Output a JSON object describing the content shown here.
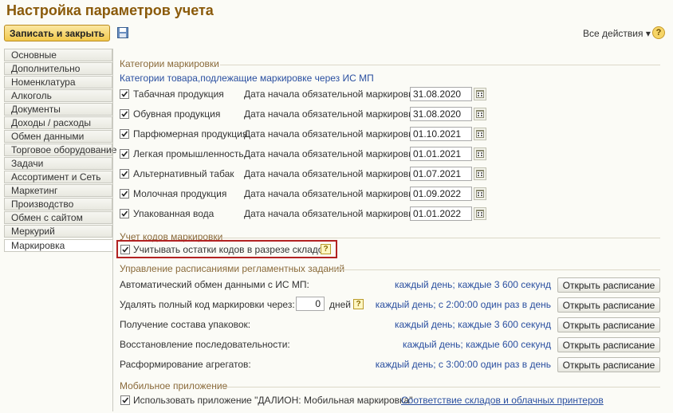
{
  "window_title": "Настройка параметров учета",
  "toolbar": {
    "save_close_label": "Записать и закрыть",
    "all_actions_label": "Все действия",
    "help_label": "?"
  },
  "sidebar": {
    "items": [
      {
        "label": "Основные"
      },
      {
        "label": "Дополнительно"
      },
      {
        "label": "Номенклатура"
      },
      {
        "label": "Алкоголь"
      },
      {
        "label": "Документы"
      },
      {
        "label": "Доходы / расходы"
      },
      {
        "label": "Обмен данными"
      },
      {
        "label": "Торговое оборудование"
      },
      {
        "label": "Задачи"
      },
      {
        "label": "Ассортимент и Сеть"
      },
      {
        "label": "Маркетинг"
      },
      {
        "label": "Производство"
      },
      {
        "label": "Обмен с сайтом"
      },
      {
        "label": "Меркурий"
      },
      {
        "label": "Маркировка"
      }
    ],
    "active": "Маркировка"
  },
  "categories": {
    "section_title": "Категории маркировки",
    "subtitle": "Категории товара,подлежащие маркировке через ИС МП",
    "date_label": "Дата начала обязательной маркировки:",
    "rows": [
      {
        "name": "Табачная продукция",
        "checked": true,
        "date": "31.08.2020"
      },
      {
        "name": "Обувная продукция",
        "checked": true,
        "date": "31.08.2020"
      },
      {
        "name": "Парфюмерная продукция",
        "checked": true,
        "date": "01.10.2021"
      },
      {
        "name": "Легкая промышленность",
        "checked": true,
        "date": "01.01.2021"
      },
      {
        "name": "Альтернативный табак",
        "checked": true,
        "date": "01.07.2021"
      },
      {
        "name": "Молочная продукция",
        "checked": true,
        "date": "01.09.2022"
      },
      {
        "name": "Упакованная вода",
        "checked": true,
        "date": "01.01.2022"
      }
    ]
  },
  "codes_accounting": {
    "section_title": "Учет кодов маркировки",
    "checkbox_label": "Учитывать остатки кодов в разрезе складов",
    "checked": true,
    "help_label": "?"
  },
  "schedules": {
    "section_title": "Управление расписаниями регламентных заданий",
    "open_label": "Открыть расписание",
    "days_label": "дней",
    "days_value": "0",
    "rows": [
      {
        "label": "Автоматический обмен данными с ИС МП:",
        "schedule": "каждый день; каждые 3 600 секунд"
      },
      {
        "label": "Удалять полный код маркировки через:",
        "schedule": "каждый день; с 2:00:00 один раз в день"
      },
      {
        "label": "Получение состава упаковок:",
        "schedule": "каждый день; каждые 3 600 секунд"
      },
      {
        "label": "Восстановление последовательности:",
        "schedule": "каждый день; каждые 600 секунд"
      },
      {
        "label": "Расформирование агрегатов:",
        "schedule": "каждый день; с 3:00:00 один раз в день"
      }
    ]
  },
  "mobile": {
    "section_title": "Мобильное приложение",
    "checkbox_label": "Использовать приложение \"ДАЛИОН: Мобильная маркировка\"",
    "checked": true,
    "link_label": "Соответствие складов и облачных принтеров"
  },
  "colors": {
    "title": "#8a5a0a",
    "link": "#2a4fa0",
    "highlight_border": "#b22222",
    "button_accent": "#f2c94c"
  }
}
